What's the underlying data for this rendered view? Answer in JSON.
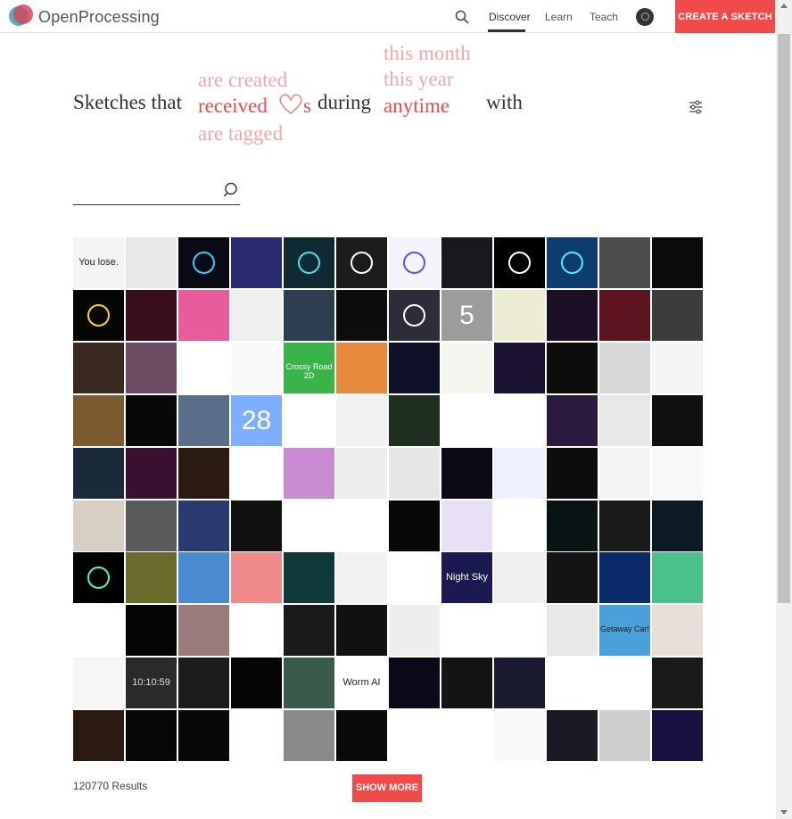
{
  "header": {
    "logo_text": "OpenProcessing",
    "nav": [
      {
        "label": "Discover",
        "active": true
      },
      {
        "label": "Learn",
        "active": false
      },
      {
        "label": "Teach",
        "active": false
      }
    ],
    "create_label": "CREATE A SKETCH"
  },
  "headline": {
    "prefix": "Sketches that",
    "verb_options": [
      "are created",
      "received",
      "are tagged"
    ],
    "verb_selected": "received",
    "verb_suffix": "s",
    "during": "during",
    "time_options": [
      "this month",
      "this year",
      "anytime"
    ],
    "time_selected": "anytime",
    "with": "with"
  },
  "search": {
    "value": "",
    "placeholder": ""
  },
  "grid": {
    "tiles": [
      {
        "t": "You lose.",
        "bg": "#f4f4f4",
        "fg": "#222"
      },
      {
        "t": "",
        "bg": "#e8e8e8"
      },
      {
        "t": "",
        "bg": "#0a0a14",
        "fg": "#2ad0ff"
      },
      {
        "t": "",
        "bg": "#2a2a6e"
      },
      {
        "t": "",
        "bg": "#0f2a33",
        "fg": "#3ee6e0"
      },
      {
        "t": "",
        "bg": "#1c1c1c",
        "fg": "#fff"
      },
      {
        "t": "",
        "bg": "#f4f4ff",
        "fg": "#6a4cff"
      },
      {
        "t": "",
        "bg": "#18181e"
      },
      {
        "t": "",
        "bg": "#000000",
        "fg": "#fff"
      },
      {
        "t": "",
        "bg": "#0c3d6e",
        "fg": "#5ae8ff"
      },
      {
        "t": "",
        "bg": "#4b4b4b"
      },
      {
        "t": "",
        "bg": "#0b0b0b"
      },
      {
        "t": "",
        "bg": "#050505",
        "fg": "#ffd700"
      },
      {
        "t": "",
        "bg": "#3a0d1e"
      },
      {
        "t": "",
        "bg": "#e95c9b"
      },
      {
        "t": "",
        "bg": "#efefef"
      },
      {
        "t": "",
        "bg": "#2c3e4f"
      },
      {
        "t": "",
        "bg": "#0d0d0d"
      },
      {
        "t": "",
        "bg": "#2c2c3a",
        "fg": "#fff"
      },
      {
        "t": "5",
        "bg": "#9c9c9c",
        "fg": "#fff"
      },
      {
        "t": "",
        "bg": "#ecebd3"
      },
      {
        "t": "",
        "bg": "#1a0f24"
      },
      {
        "t": "",
        "bg": "#5d1320"
      },
      {
        "t": "",
        "bg": "#3c3c3c"
      },
      {
        "t": "",
        "bg": "#3a2a20"
      },
      {
        "t": "",
        "bg": "#6b4a62"
      },
      {
        "t": "",
        "bg": "#ffffff"
      },
      {
        "t": "",
        "bg": "#fafafa"
      },
      {
        "t": "Crossy Road 2D",
        "bg": "#3bb34b",
        "fg": "#fff"
      },
      {
        "t": "",
        "bg": "#e58a3c"
      },
      {
        "t": "",
        "bg": "#101028"
      },
      {
        "t": "",
        "bg": "#f6f6f0"
      },
      {
        "t": "",
        "bg": "#1a1030"
      },
      {
        "t": "",
        "bg": "#0d0d0d"
      },
      {
        "t": "",
        "bg": "#d8d8d8"
      },
      {
        "t": "",
        "bg": "#f5f5f5"
      },
      {
        "t": "",
        "bg": "#7a5a2e"
      },
      {
        "t": "",
        "bg": "#080808"
      },
      {
        "t": "",
        "bg": "#5a6e8a"
      },
      {
        "t": "28",
        "bg": "#7eaeff",
        "fg": "#fff"
      },
      {
        "t": "",
        "bg": "#ffffff"
      },
      {
        "t": "",
        "bg": "#f2f2f2"
      },
      {
        "t": "",
        "bg": "#1f3020"
      },
      {
        "t": "",
        "bg": "#ffffff"
      },
      {
        "t": "",
        "bg": "#ffffff"
      },
      {
        "t": "",
        "bg": "#2a1a40"
      },
      {
        "t": "",
        "bg": "#e8e8e8"
      },
      {
        "t": "",
        "bg": "#101010"
      },
      {
        "t": "",
        "bg": "#1a2a3a"
      },
      {
        "t": "",
        "bg": "#3a1030"
      },
      {
        "t": "",
        "bg": "#2a1a10"
      },
      {
        "t": "",
        "bg": "#ffffff"
      },
      {
        "t": "",
        "bg": "#c88ad0"
      },
      {
        "t": "",
        "bg": "#eeeeee"
      },
      {
        "t": "",
        "bg": "#e6e6e6"
      },
      {
        "t": "",
        "bg": "#0a0a14"
      },
      {
        "t": "",
        "bg": "#eef0ff"
      },
      {
        "t": "",
        "bg": "#0d0d0d"
      },
      {
        "t": "",
        "bg": "#f4f4f4"
      },
      {
        "t": "",
        "bg": "#f8f8f8"
      },
      {
        "t": "",
        "bg": "#d8cfc4"
      },
      {
        "t": "",
        "bg": "#5a5a5a"
      },
      {
        "t": "",
        "bg": "#2a3a70"
      },
      {
        "t": "",
        "bg": "#111111"
      },
      {
        "t": "",
        "bg": "#ffffff"
      },
      {
        "t": "",
        "bg": "#ffffff"
      },
      {
        "t": "",
        "bg": "#080808"
      },
      {
        "t": "",
        "bg": "#e8e0f6"
      },
      {
        "t": "",
        "bg": "#ffffff"
      },
      {
        "t": "",
        "bg": "#0a1414"
      },
      {
        "t": "",
        "bg": "#1a1a1a"
      },
      {
        "t": "",
        "bg": "#0c1a24"
      },
      {
        "t": "",
        "bg": "#000000",
        "fg": "#3effc0"
      },
      {
        "t": "",
        "bg": "#6a6a2a"
      },
      {
        "t": "",
        "bg": "#4a8ad0"
      },
      {
        "t": "",
        "bg": "#f08a8a"
      },
      {
        "t": "",
        "bg": "#103a3a"
      },
      {
        "t": "",
        "bg": "#f2f2f2"
      },
      {
        "t": "",
        "bg": "#ffffff"
      },
      {
        "t": "Night Sky",
        "bg": "#1a1a50",
        "fg": "#fff"
      },
      {
        "t": "",
        "bg": "#f0f0f0"
      },
      {
        "t": "",
        "bg": "#141414"
      },
      {
        "t": "",
        "bg": "#0a2a6a"
      },
      {
        "t": "",
        "bg": "#4ac08a"
      },
      {
        "t": "",
        "bg": "#ffffff"
      },
      {
        "t": "",
        "bg": "#040404"
      },
      {
        "t": "",
        "bg": "#9a7a7a"
      },
      {
        "t": "",
        "bg": "#ffffff"
      },
      {
        "t": "",
        "bg": "#1a1a1a"
      },
      {
        "t": "",
        "bg": "#111111"
      },
      {
        "t": "",
        "bg": "#eeeeee"
      },
      {
        "t": "",
        "bg": "#ffffff"
      },
      {
        "t": "",
        "bg": "#ffffff"
      },
      {
        "t": "",
        "bg": "#e8e8e8"
      },
      {
        "t": "Getaway Car!",
        "bg": "#4aa0d8",
        "fg": "#222"
      },
      {
        "t": "",
        "bg": "#e6e0d8"
      },
      {
        "t": "",
        "bg": "#f6f6f6"
      },
      {
        "t": "10:10:59",
        "bg": "#2a2a2a",
        "fg": "#ddd"
      },
      {
        "t": "",
        "bg": "#1c1c1c"
      },
      {
        "t": "",
        "bg": "#050505"
      },
      {
        "t": "",
        "bg": "#3a5a4a"
      },
      {
        "t": "Worm AI",
        "bg": "#ffffff",
        "fg": "#222"
      },
      {
        "t": "",
        "bg": "#0a0a1a"
      },
      {
        "t": "",
        "bg": "#141414"
      },
      {
        "t": "",
        "bg": "#1a1a30"
      },
      {
        "t": "",
        "bg": "#ffffff"
      },
      {
        "t": "",
        "bg": "#ffffff"
      },
      {
        "t": "",
        "bg": "#1a1a1a"
      },
      {
        "t": "",
        "bg": "#2a1a10"
      },
      {
        "t": "",
        "bg": "#060606"
      },
      {
        "t": "",
        "bg": "#080808"
      },
      {
        "t": "",
        "bg": "#ffffff"
      },
      {
        "t": "",
        "bg": "#8a8a8a"
      },
      {
        "t": "",
        "bg": "#0a0a0a"
      },
      {
        "t": "",
        "bg": "#ffffff"
      },
      {
        "t": "",
        "bg": "#ffffff"
      },
      {
        "t": "",
        "bg": "#f8f8f8"
      },
      {
        "t": "",
        "bg": "#1a1a24"
      },
      {
        "t": "",
        "bg": "#cfcfcf"
      },
      {
        "t": "",
        "bg": "#1a1040"
      }
    ]
  },
  "footer": {
    "results": "120770 Results",
    "more_label": "SHOW MORE"
  }
}
